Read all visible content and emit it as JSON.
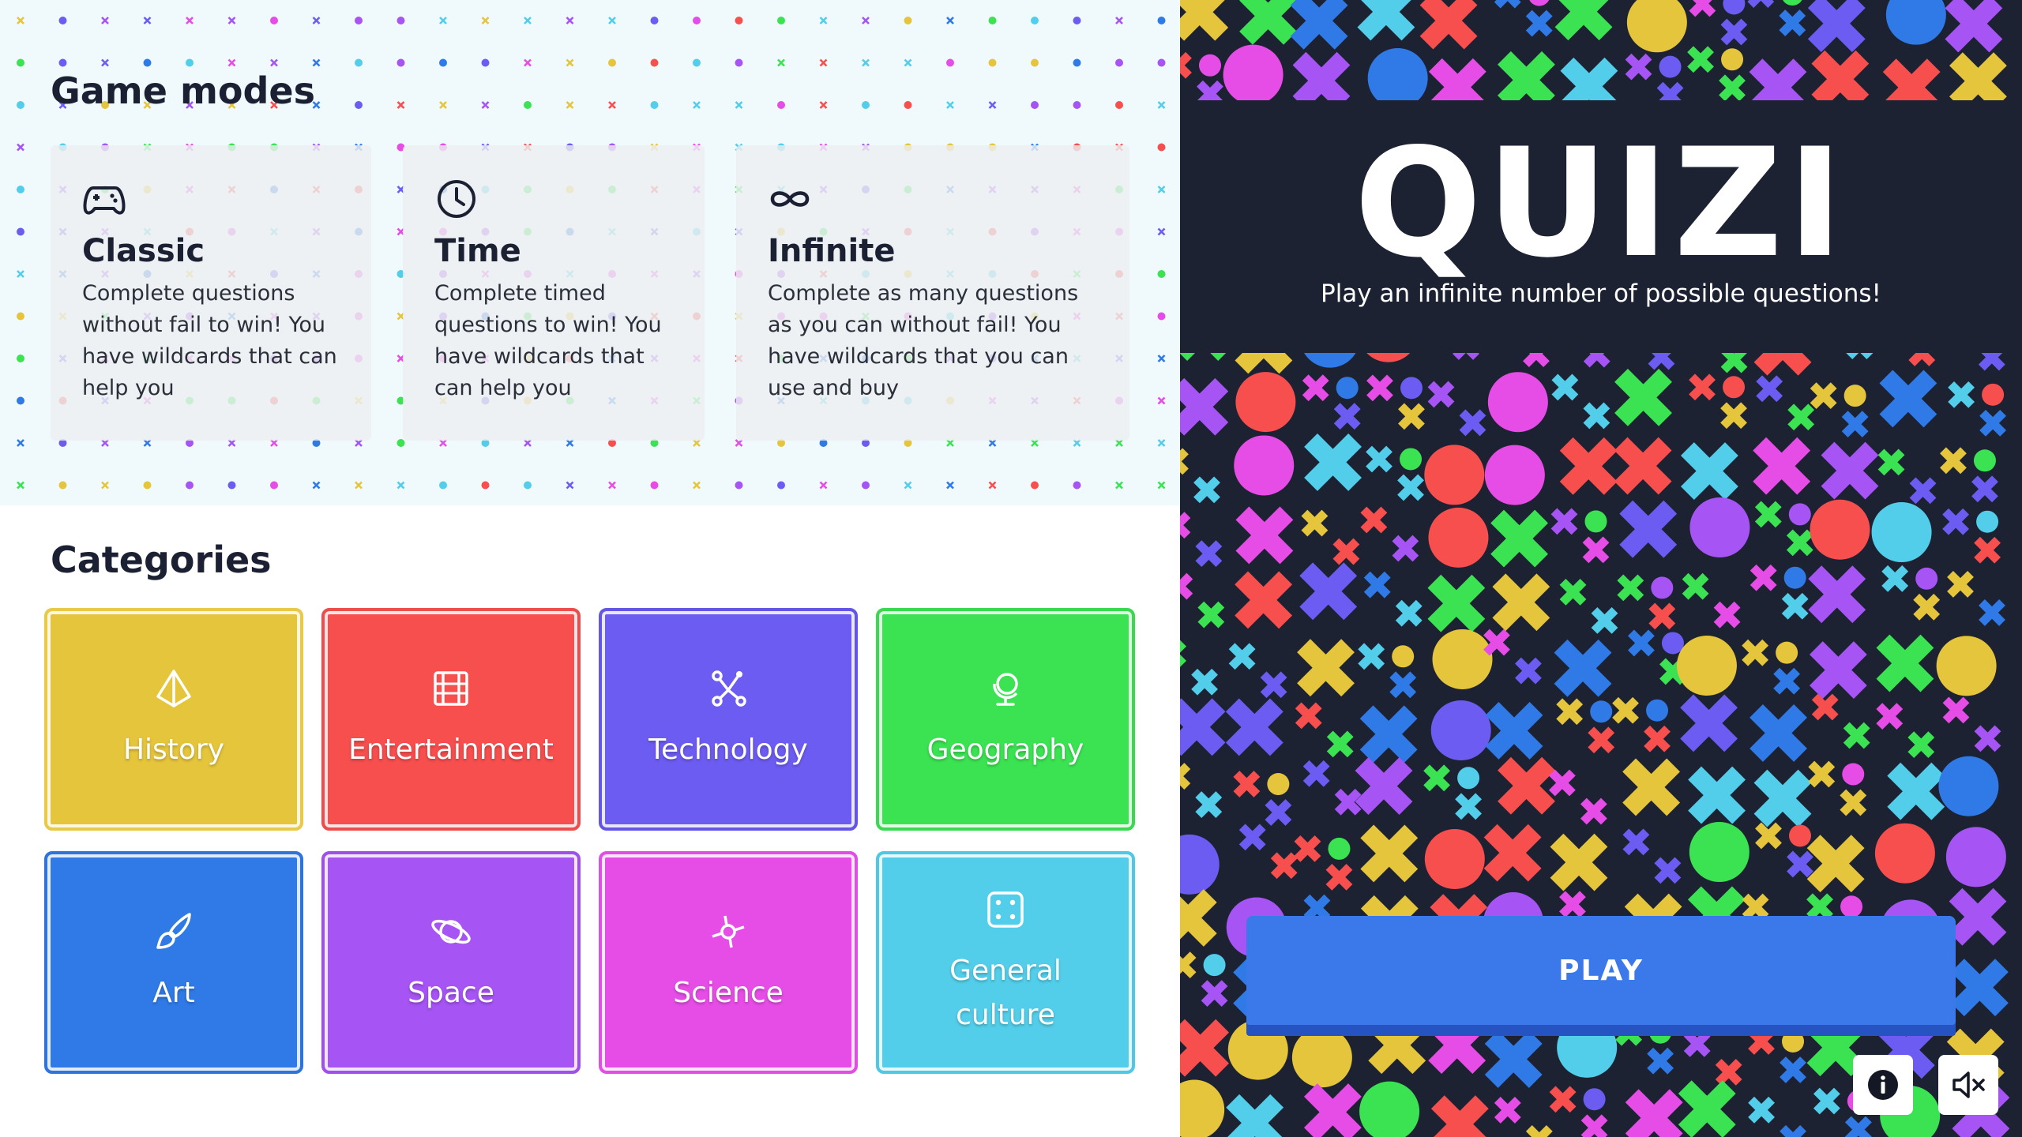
{
  "left": {
    "modes_title": "Game modes",
    "modes": [
      {
        "icon": "gamepad-icon",
        "name": "Classic",
        "desc": "Complete questions without fail to win! You have wildcards that can help you"
      },
      {
        "icon": "clock-icon",
        "name": "Time",
        "desc": "Complete timed questions to win! You have wildcards that can help you"
      },
      {
        "icon": "infinity-icon",
        "name": "Infinite",
        "desc": "Complete as many questions as you can without fail! You have wildcards that you can use and buy"
      }
    ],
    "categories_title": "Categories",
    "categories": [
      {
        "label": "History",
        "icon": "pyramid-icon",
        "color": "#e5c53b",
        "border": "#e8c94a"
      },
      {
        "label": "Entertainment",
        "icon": "film-icon",
        "color": "#f74e4e",
        "border": "#ec4d4d"
      },
      {
        "label": "Technology",
        "icon": "network-icon",
        "color": "#6d5cf2",
        "border": "#6356e6"
      },
      {
        "label": "Geography",
        "icon": "globe-icon",
        "color": "#3be352",
        "border": "#3bd851"
      },
      {
        "label": "Art",
        "icon": "brush-icon",
        "color": "#2f7ae6",
        "border": "#2f74db"
      },
      {
        "label": "Space",
        "icon": "planet-icon",
        "color": "#a654f4",
        "border": "#9f50ea"
      },
      {
        "label": "Science",
        "icon": "atom-icon",
        "color": "#e64de6",
        "border": "#e14ee3"
      },
      {
        "label": "General culture",
        "icon": "dice-icon",
        "color": "#53ceea",
        "border": "#4fc8e6"
      }
    ]
  },
  "right": {
    "logo": "QUIZI",
    "tagline": "Play an infinite number of possible questions!",
    "play_label": "PLAY",
    "info_icon": "info-icon",
    "mute_icon": "volume-mute-icon",
    "pattern_colors": [
      "#e5c53b",
      "#f74e4e",
      "#6d5cf2",
      "#3be352",
      "#2f7ae6",
      "#a654f4",
      "#e64de6",
      "#53ceea"
    ]
  }
}
